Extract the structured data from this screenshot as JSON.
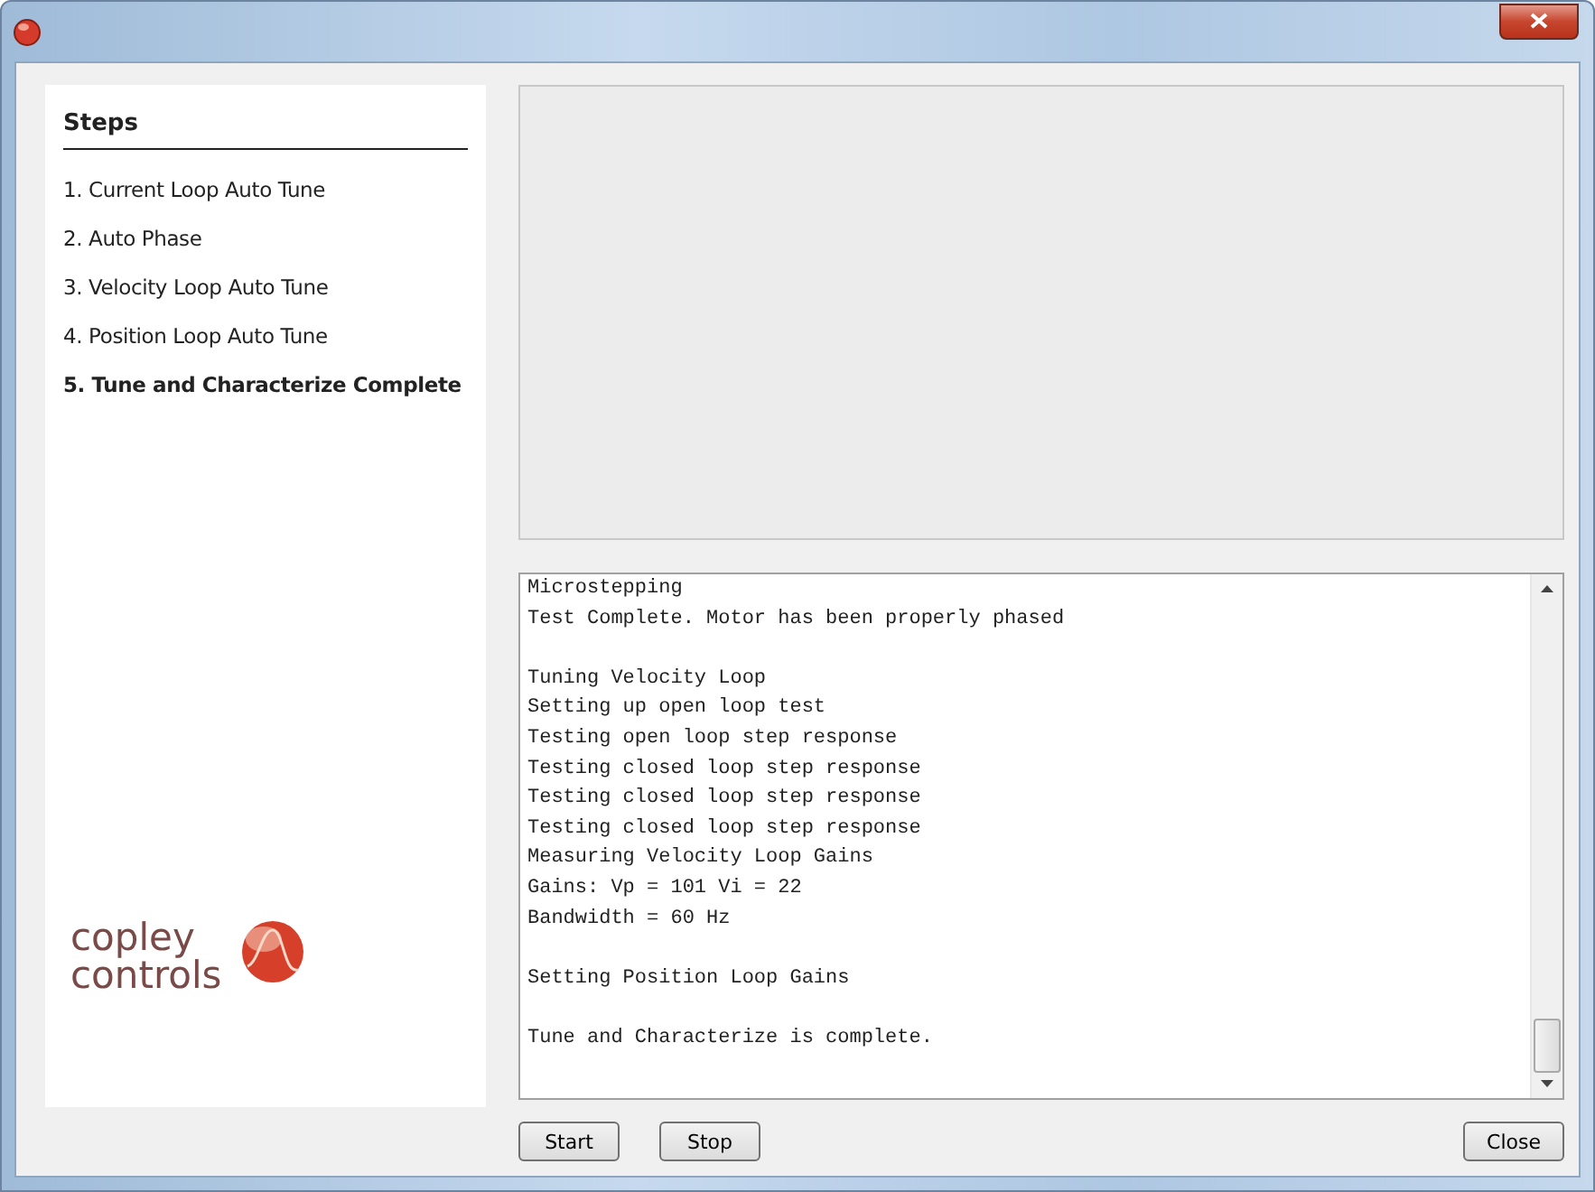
{
  "steps": {
    "title": "Steps",
    "items": [
      {
        "label": "1. Current Loop Auto Tune",
        "selected": false
      },
      {
        "label": "2. Auto Phase",
        "selected": false
      },
      {
        "label": "3. Velocity Loop Auto Tune",
        "selected": false
      },
      {
        "label": "4. Position Loop Auto Tune",
        "selected": false
      },
      {
        "label": "5. Tune and Characterize Complete",
        "selected": true
      }
    ]
  },
  "logo": {
    "line_1": "copley",
    "line_2": "controls"
  },
  "log": [
    {
      "lines": [
        "Microstepping",
        "Test Complete. Motor has been properly phased"
      ]
    },
    {
      "lines": [
        "Tuning Velocity Loop",
        "Setting up open loop test",
        "Testing open loop step response",
        "Testing closed loop step response",
        "Testing closed loop step response",
        "Testing closed loop step response",
        "Measuring Velocity Loop Gains",
        "Gains: Vp = 101 Vi = 22",
        "Bandwidth = 60 Hz"
      ]
    },
    {
      "lines": [
        "Setting Position Loop Gains"
      ]
    },
    {
      "lines": [
        "Tune and Characterize is complete."
      ]
    }
  ],
  "buttons": {
    "left": [
      "Start",
      "Stop"
    ],
    "right": [
      "Close"
    ]
  }
}
